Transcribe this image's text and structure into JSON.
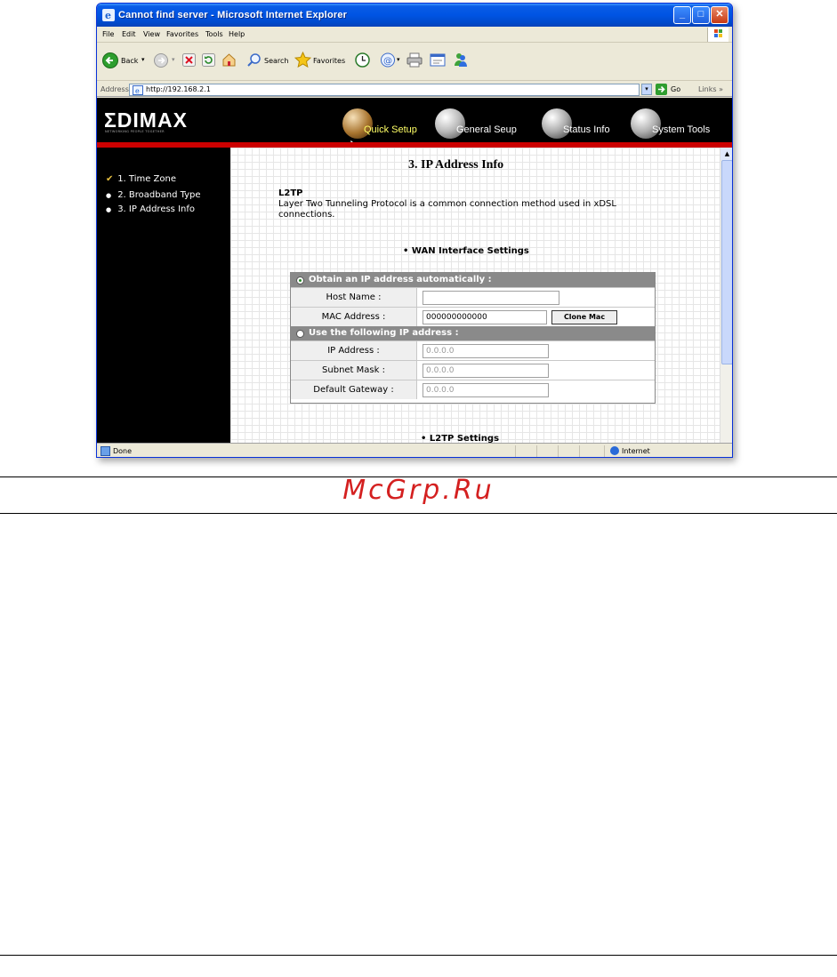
{
  "window": {
    "title": "Cannot find server - Microsoft Internet Explorer",
    "min_symbol": "_",
    "max_symbol": "□",
    "close_symbol": "✕"
  },
  "menubar": [
    "File",
    "Edit",
    "View",
    "Favorites",
    "Tools",
    "Help"
  ],
  "toolbar": {
    "back_label": "Back",
    "search_label": "Search",
    "favorites_label": "Favorites"
  },
  "address_bar": {
    "label": "Address",
    "url": "http://192.168.2.1",
    "go_label": "Go",
    "links_label": "Links »"
  },
  "banner": {
    "logo": "ΣDIMAX",
    "tagline": "NETWORKING PEOPLE TOGETHER",
    "nav": [
      {
        "label": "Quick Setup",
        "active": true
      },
      {
        "label": "General Seup",
        "active": false
      },
      {
        "label": "Status Info",
        "active": false
      },
      {
        "label": "System Tools",
        "active": false
      }
    ]
  },
  "sidebar": {
    "steps": [
      {
        "marker": "✔",
        "label": "1. Time Zone"
      },
      {
        "marker": "●",
        "label": "2. Broadband Type"
      },
      {
        "marker": "●",
        "label": "3. IP Address Info"
      }
    ]
  },
  "content": {
    "title": "3. IP Address Info",
    "protocol": "L2TP",
    "description": "Layer Two Tunneling Protocol is a common connection method used in xDSL connections.",
    "wan_header": "• WAN Interface Settings",
    "l2tp_header": "• L2TP Settings",
    "auto_section": "Obtain an IP address automatically :",
    "static_section": "Use the following IP address :",
    "rows_auto": [
      {
        "label": "Host Name :",
        "value": ""
      },
      {
        "label": "MAC Address :",
        "value": "000000000000"
      }
    ],
    "clone_mac_label": "Clone Mac",
    "rows_static": [
      {
        "label": "IP Address :",
        "value": "0.0.0.0"
      },
      {
        "label": "Subnet Mask :",
        "value": "0.0.0.0"
      },
      {
        "label": "Default Gateway :",
        "value": "0.0.0.0"
      }
    ]
  },
  "statusbar": {
    "status": "Done",
    "zone": "Internet"
  },
  "watermark": "McGrp.Ru",
  "colors": {
    "banner_red": "#cc0000",
    "xp_blue": "#0054e3",
    "active_nav": "#ffff66",
    "watermark": "#d42020"
  }
}
